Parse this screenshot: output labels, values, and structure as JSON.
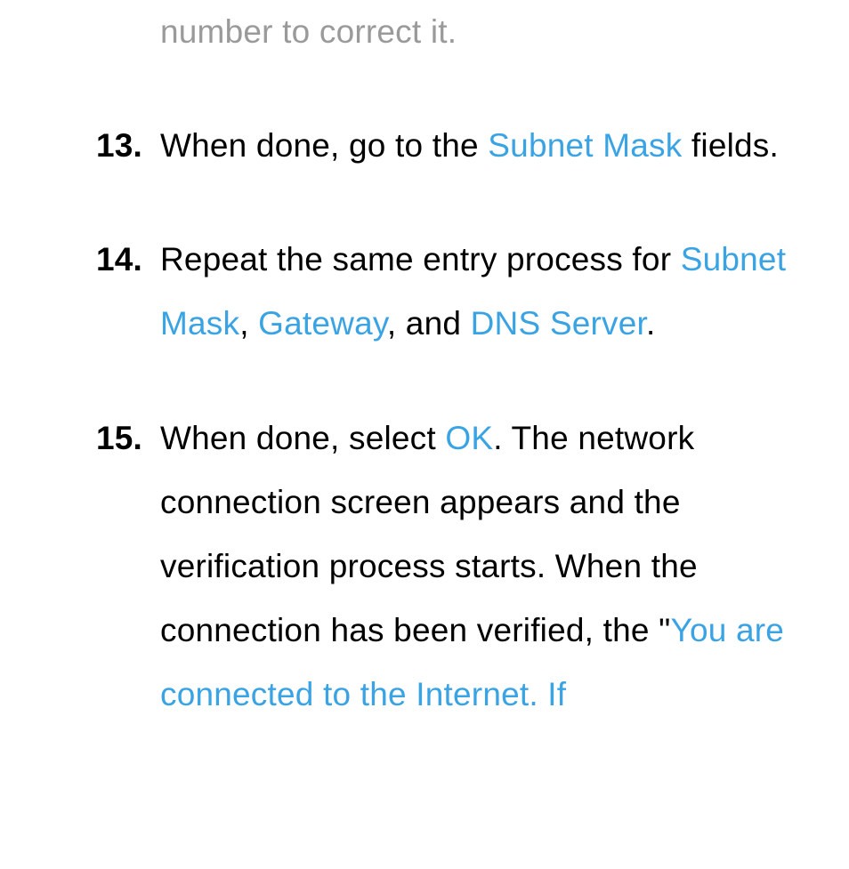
{
  "trail_text": "number to correct it.",
  "items": [
    {
      "num": "13.",
      "segments": [
        {
          "text": "When done, go to the ",
          "hl": false
        },
        {
          "text": "Subnet Mask",
          "hl": true
        },
        {
          "text": " fields.",
          "hl": false
        }
      ]
    },
    {
      "num": "14.",
      "segments": [
        {
          "text": "Repeat the same entry process for ",
          "hl": false
        },
        {
          "text": "Subnet Mask",
          "hl": true
        },
        {
          "text": ", ",
          "hl": false
        },
        {
          "text": "Gateway",
          "hl": true
        },
        {
          "text": ", and ",
          "hl": false
        },
        {
          "text": "DNS Server",
          "hl": true
        },
        {
          "text": ".",
          "hl": false
        }
      ]
    },
    {
      "num": "15.",
      "segments": [
        {
          "text": "When done, select ",
          "hl": false
        },
        {
          "text": "OK",
          "hl": true
        },
        {
          "text": ". The network connection screen appears and the verification process starts. When the connection has been verified, the \"",
          "hl": false
        },
        {
          "text": "You are connected to the Internet. If",
          "hl": true
        }
      ]
    }
  ]
}
